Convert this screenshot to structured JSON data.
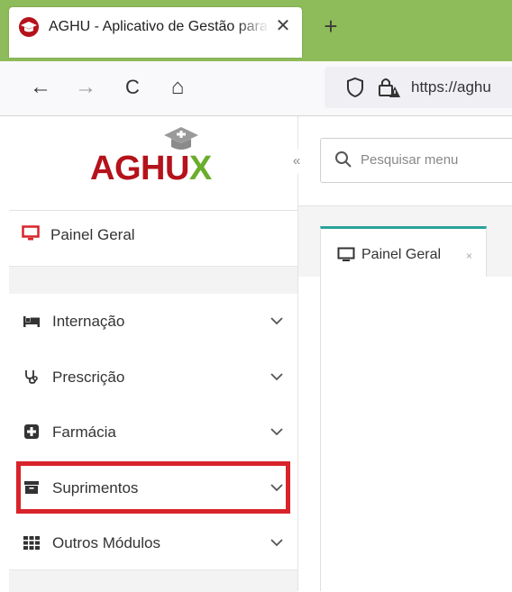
{
  "browser": {
    "tab_title": "AGHU - Aplicativo de Gestão para Hospitais Universitários",
    "tab_close": "✕",
    "new_tab": "+",
    "url": "https://aghu",
    "nav": {
      "back": "←",
      "forward": "→",
      "reload": "C",
      "home": "⌂"
    },
    "icons": [
      "back-icon",
      "forward-icon",
      "reload-icon",
      "home-icon",
      "shield-icon",
      "lock-icon",
      "graduation-cap-icon"
    ],
    "theme_color": "#8fbc5a"
  },
  "app": {
    "logo": {
      "main": "AGHU",
      "accent": "X"
    },
    "collapse_label": "«",
    "search_placeholder": "Pesquisar menu",
    "sidebar": {
      "painel": "Painel Geral",
      "items": [
        {
          "label": "Internação",
          "icon": "bed-icon"
        },
        {
          "label": "Prescrição",
          "icon": "stethoscope-icon"
        },
        {
          "label": "Farmácia",
          "icon": "medical-plus-icon"
        },
        {
          "label": "Suprimentos",
          "icon": "archive-box-icon",
          "highlighted": true
        },
        {
          "label": "Outros Módulos",
          "icon": "grid-icon"
        }
      ]
    },
    "page_tab": {
      "label": "Painel Geral",
      "close": "×"
    },
    "colors": {
      "brand_red": "#b5121b",
      "brand_green": "#6aad2c",
      "highlight": "#d8232a",
      "active_tab": "#2aa39a"
    }
  }
}
